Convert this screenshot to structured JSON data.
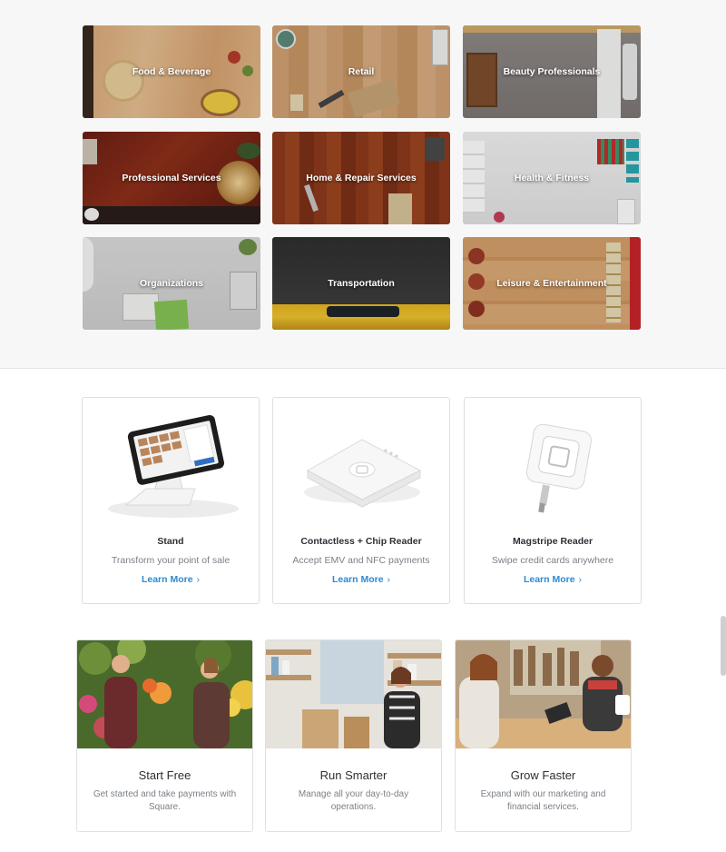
{
  "industries": [
    {
      "label": "Food & Beverage"
    },
    {
      "label": "Retail"
    },
    {
      "label": "Beauty Professionals"
    },
    {
      "label": "Professional Services"
    },
    {
      "label": "Home & Repair Services"
    },
    {
      "label": "Health & Fitness"
    },
    {
      "label": "Organizations"
    },
    {
      "label": "Transportation"
    },
    {
      "label": "Leisure & Entertainment"
    }
  ],
  "products": [
    {
      "title": "Stand",
      "desc": "Transform your point of sale",
      "link": "Learn More",
      "link_icon": "chevron-right-icon"
    },
    {
      "title": "Contactless + Chip Reader",
      "desc": "Accept EMV and NFC payments",
      "link": "Learn More",
      "link_icon": "chevron-right-icon"
    },
    {
      "title": "Magstripe Reader",
      "desc": "Swipe credit cards anywhere",
      "link": "Learn More",
      "link_icon": "chevron-right-icon"
    }
  ],
  "features": [
    {
      "title": "Start Free",
      "desc": "Get started and take payments with Square."
    },
    {
      "title": "Run Smarter",
      "desc": "Manage all your day-to-day operations."
    },
    {
      "title": "Grow Faster",
      "desc": "Expand with our marketing and financial services."
    }
  ],
  "colors": {
    "link": "#2c8ad3",
    "section_bg": "#f7f7f7"
  }
}
